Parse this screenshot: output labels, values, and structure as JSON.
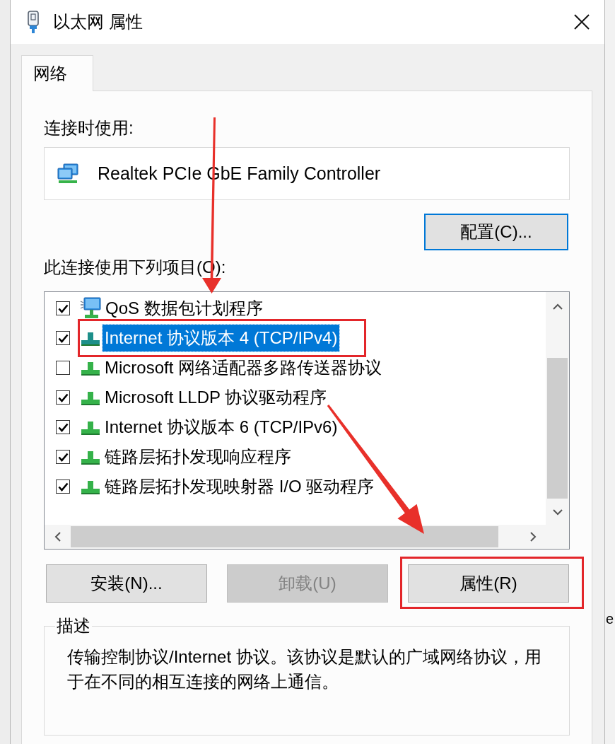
{
  "window": {
    "title": "以太网 属性"
  },
  "tabs": [
    {
      "label": "网络",
      "selected": true
    }
  ],
  "connect_using": {
    "label": "连接时使用:",
    "adapter": "Realtek PCIe GbE Family Controller",
    "configure_button": {
      "label": "配置(C)...",
      "focused": true
    }
  },
  "components": {
    "label": "此连接使用下列项目(O):",
    "items": [
      {
        "kind": "service",
        "label": "QoS 数据包计划程序",
        "checked": true,
        "selected": false,
        "annotated": false
      },
      {
        "kind": "protocol",
        "label": "Internet 协议版本 4 (TCP/IPv4)",
        "checked": true,
        "selected": true,
        "annotated": true
      },
      {
        "kind": "protocol",
        "label": "Microsoft 网络适配器多路传送器协议",
        "checked": false,
        "selected": false,
        "annotated": false
      },
      {
        "kind": "protocol",
        "label": "Microsoft LLDP 协议驱动程序",
        "checked": true,
        "selected": false,
        "annotated": false
      },
      {
        "kind": "protocol",
        "label": "Internet 协议版本 6 (TCP/IPv6)",
        "checked": true,
        "selected": false,
        "annotated": false
      },
      {
        "kind": "protocol",
        "label": "链路层拓扑发现响应程序",
        "checked": true,
        "selected": false,
        "annotated": false
      },
      {
        "kind": "protocol",
        "label": "链路层拓扑发现映射器 I/O 驱动程序",
        "checked": true,
        "selected": false,
        "annotated": false
      }
    ]
  },
  "buttons": [
    {
      "label": "安装(N)...",
      "disabled": false,
      "annotated": false
    },
    {
      "label": "卸载(U)",
      "disabled": true,
      "annotated": false
    },
    {
      "label": "属性(R)",
      "disabled": false,
      "annotated": true
    }
  ],
  "description": {
    "title": "描述",
    "text": "传输控制协议/Internet 协议。该协议是默认的广域网络协议，用于在不同的相互连接的网络上通信。"
  },
  "background_window": {
    "text": "e"
  }
}
